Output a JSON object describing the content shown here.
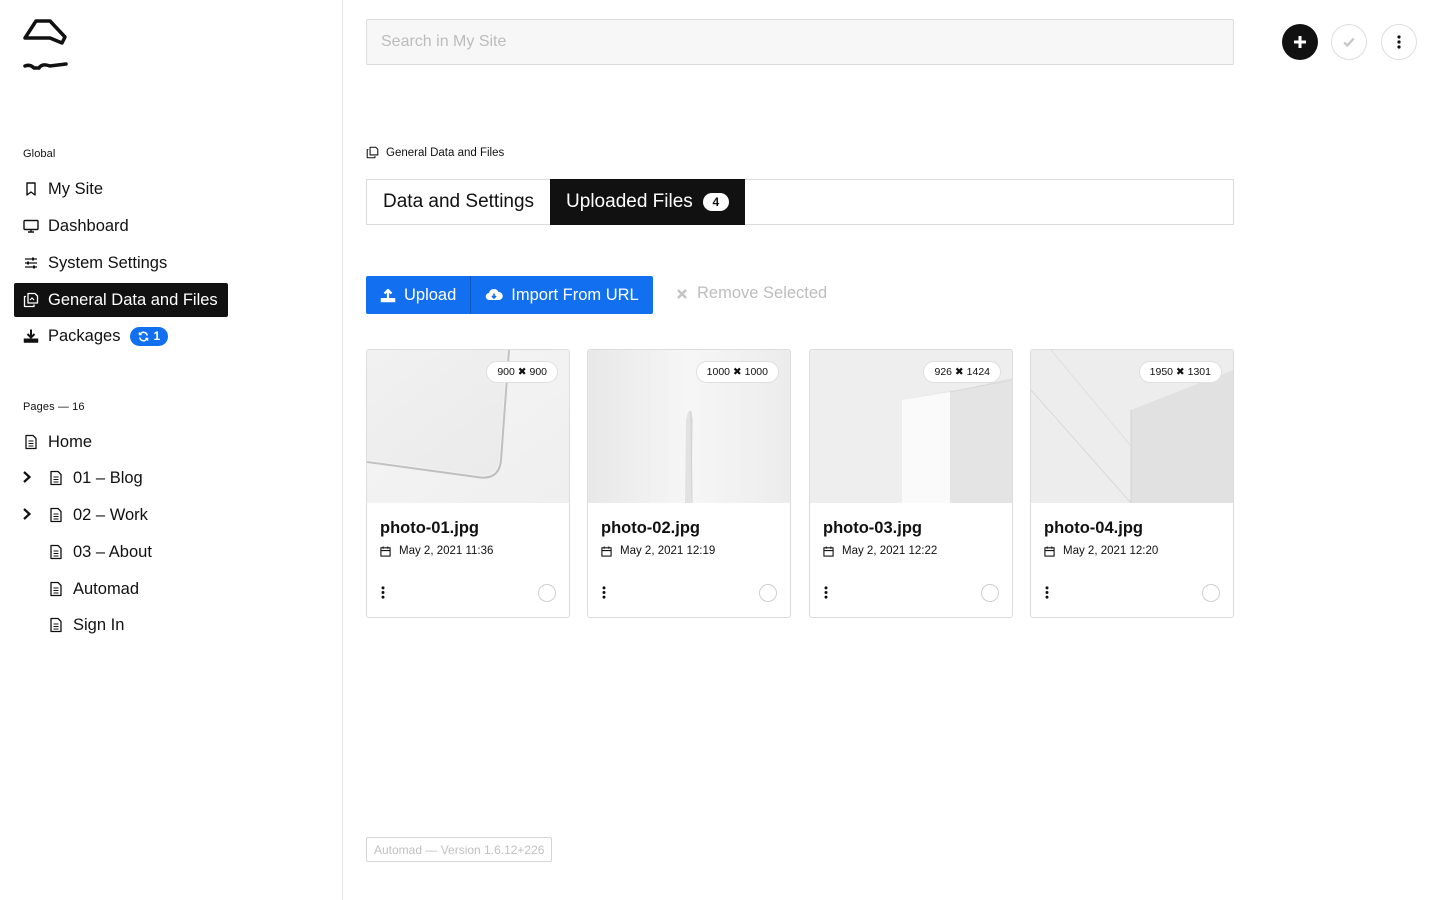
{
  "sidebar": {
    "global_title": "Global",
    "nav": [
      {
        "label": "My Site",
        "icon": "bookmark-icon"
      },
      {
        "label": "Dashboard",
        "icon": "monitor-icon"
      },
      {
        "label": "System Settings",
        "icon": "sliders-icon"
      },
      {
        "label": "General Data and Files",
        "icon": "files-icon",
        "active": true
      },
      {
        "label": "Packages",
        "icon": "download-icon",
        "badge": "1"
      }
    ],
    "pages_title": "Pages — 16",
    "pages": [
      {
        "label": "Home"
      },
      {
        "label": "01 – Blog",
        "expandable": true
      },
      {
        "label": "02 – Work",
        "expandable": true
      },
      {
        "label": "03 – About"
      },
      {
        "label": "Automad"
      },
      {
        "label": "Sign In"
      }
    ]
  },
  "header": {
    "search_placeholder": "Search in My Site"
  },
  "breadcrumb": {
    "label": "General Data and Files"
  },
  "tabs": [
    {
      "label": "Data and Settings"
    },
    {
      "label": "Uploaded Files",
      "count": "4",
      "active": true
    }
  ],
  "toolbar": {
    "upload_label": "Upload",
    "import_label": "Import From URL",
    "remove_label": "Remove Selected"
  },
  "files": [
    {
      "name": "photo-01.jpg",
      "date": "May 2, 2021 11:36",
      "dims": "900 ✖ 900"
    },
    {
      "name": "photo-02.jpg",
      "date": "May 2, 2021 12:19",
      "dims": "1000 ✖ 1000"
    },
    {
      "name": "photo-03.jpg",
      "date": "May 2, 2021 12:22",
      "dims": "926 ✖ 1424"
    },
    {
      "name": "photo-04.jpg",
      "date": "May 2, 2021 12:20",
      "dims": "1950 ✖ 1301"
    }
  ],
  "footer": {
    "version": "Automad — Version 1.6.12+226"
  },
  "colors": {
    "accent": "#1270f0",
    "active_bg": "#111111"
  }
}
